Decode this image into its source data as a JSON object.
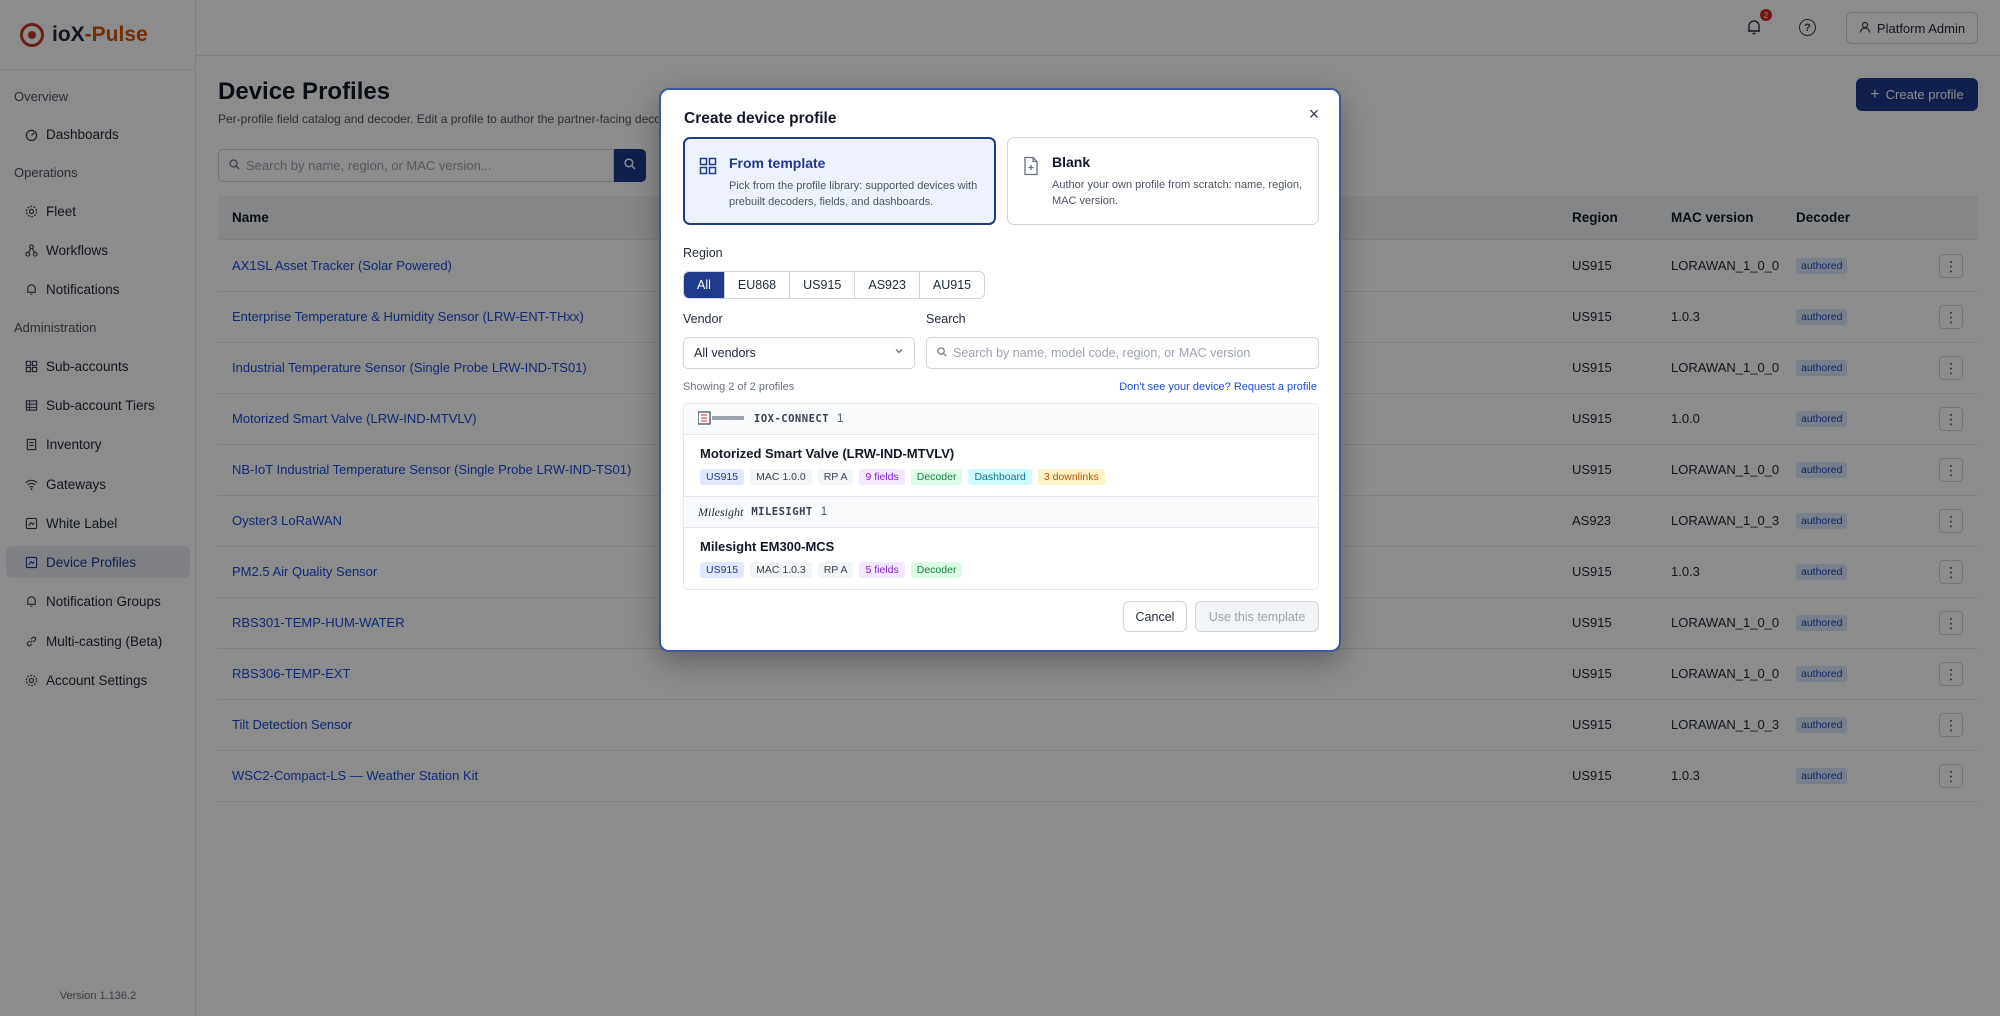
{
  "app": {
    "brand_prefix": "ioX",
    "brand_suffix": "-Pulse",
    "version": "Version 1.136.2"
  },
  "topbar": {
    "notification_count": "2",
    "help_glyph": "?",
    "user_label": "Platform Admin"
  },
  "sidebar": {
    "sections": [
      {
        "label": "Overview"
      },
      {
        "label": "Operations"
      },
      {
        "label": "Administration"
      }
    ],
    "items": [
      {
        "label": "Dashboards",
        "icon": "dashboard-icon"
      },
      {
        "label": "Fleet",
        "icon": "gear-icon"
      },
      {
        "label": "Workflows",
        "icon": "workflow-icon"
      },
      {
        "label": "Notifications",
        "icon": "bell-icon"
      },
      {
        "label": "Sub-accounts",
        "icon": "grid-icon"
      },
      {
        "label": "Sub-account Tiers",
        "icon": "tiers-icon"
      },
      {
        "label": "Inventory",
        "icon": "inventory-icon"
      },
      {
        "label": "Gateways",
        "icon": "wifi-icon"
      },
      {
        "label": "White Label",
        "icon": "tag-icon"
      },
      {
        "label": "Device Profiles",
        "icon": "profile-icon"
      },
      {
        "label": "Notification Groups",
        "icon": "bell-icon"
      },
      {
        "label": "Multi-casting (Beta)",
        "icon": "link-icon"
      },
      {
        "label": "Account Settings",
        "icon": "gear-icon"
      }
    ]
  },
  "page": {
    "title": "Device Profiles",
    "subtitle": "Per-profile field catalog and decoder. Edit a profile to author the partner-facing decode",
    "create_label": "Create profile",
    "search_placeholder": "Search by name, region, or MAC version..."
  },
  "table": {
    "columns": [
      "Name",
      "Region",
      "MAC version",
      "Decoder"
    ],
    "rows": [
      {
        "name": "AX1SL Asset Tracker (Solar Powered)",
        "region": "US915",
        "mac": "LORAWAN_1_0_0",
        "decoder": "authored"
      },
      {
        "name": "Enterprise Temperature & Humidity Sensor (LRW-ENT-THxx)",
        "region": "US915",
        "mac": "1.0.3",
        "decoder": "authored"
      },
      {
        "name": "Industrial Temperature Sensor (Single Probe LRW-IND-TS01)",
        "region": "US915",
        "mac": "LORAWAN_1_0_0",
        "decoder": "authored"
      },
      {
        "name": "Motorized Smart Valve (LRW-IND-MTVLV)",
        "region": "US915",
        "mac": "1.0.0",
        "decoder": "authored"
      },
      {
        "name": "NB-IoT Industrial Temperature Sensor (Single Probe LRW-IND-TS01)",
        "region": "US915",
        "mac": "LORAWAN_1_0_0",
        "decoder": "authored"
      },
      {
        "name": "Oyster3 LoRaWAN",
        "region": "AS923",
        "mac": "LORAWAN_1_0_3",
        "decoder": "authored"
      },
      {
        "name": "PM2.5 Air Quality Sensor",
        "region": "US915",
        "mac": "1.0.3",
        "decoder": "authored"
      },
      {
        "name": "RBS301-TEMP-HUM-WATER",
        "region": "US915",
        "mac": "LORAWAN_1_0_0",
        "decoder": "authored"
      },
      {
        "name": "RBS306-TEMP-EXT",
        "region": "US915",
        "mac": "LORAWAN_1_0_0",
        "decoder": "authored"
      },
      {
        "name": "Tilt Detection Sensor",
        "region": "US915",
        "mac": "LORAWAN_1_0_3",
        "decoder": "authored"
      },
      {
        "name": "WSC2-Compact-LS — Weather Station Kit",
        "region": "US915",
        "mac": "1.0.3",
        "decoder": "authored"
      }
    ]
  },
  "modal": {
    "title": "Create device profile",
    "close_glyph": "×",
    "options": [
      {
        "title": "From template",
        "desc": "Pick from the profile library: supported devices with prebuilt decoders, fields, and dashboards.",
        "selected": true
      },
      {
        "title": "Blank",
        "desc": "Author your own profile from scratch: name, region, MAC version.",
        "selected": false
      }
    ],
    "region_label": "Region",
    "regions": [
      "All",
      "EU868",
      "US915",
      "AS923",
      "AU915"
    ],
    "region_selected": "All",
    "vendor_label": "Vendor",
    "vendor_value": "All vendors",
    "search_label": "Search",
    "search_placeholder": "Search by name, model code, region, or MAC version",
    "showing": "Showing 2 of 2 profiles",
    "request_link": "Don't see your device? Request a profile",
    "groups": [
      {
        "vendor_logo": "ioX-Connect",
        "vendor": "IOX-CONNECT",
        "count": "1",
        "devices": [
          {
            "name": "Motorized Smart Valve (LRW-IND-MTVLV)",
            "chips": {
              "region": "US915",
              "mac": "MAC 1.0.0",
              "rp": "RP A",
              "fields": "9 fields",
              "decoder": "Decoder",
              "dashboard": "Dashboard",
              "downlinks": "3 downlinks"
            }
          }
        ]
      },
      {
        "vendor_logo": "Milesight",
        "vendor": "MILESIGHT",
        "count": "1",
        "devices": [
          {
            "name": "Milesight EM300-MCS",
            "chips": {
              "region": "US915",
              "mac": "MAC 1.0.3",
              "rp": "RP A",
              "fields": "5 fields",
              "decoder": "Decoder"
            }
          }
        ]
      }
    ],
    "cancel_label": "Cancel",
    "use_label": "Use this template"
  },
  "colors": {
    "primary": "#1e3a8a",
    "link": "#1d4ed8",
    "brand_accent": "#d35400",
    "badge": "#dc2626"
  }
}
